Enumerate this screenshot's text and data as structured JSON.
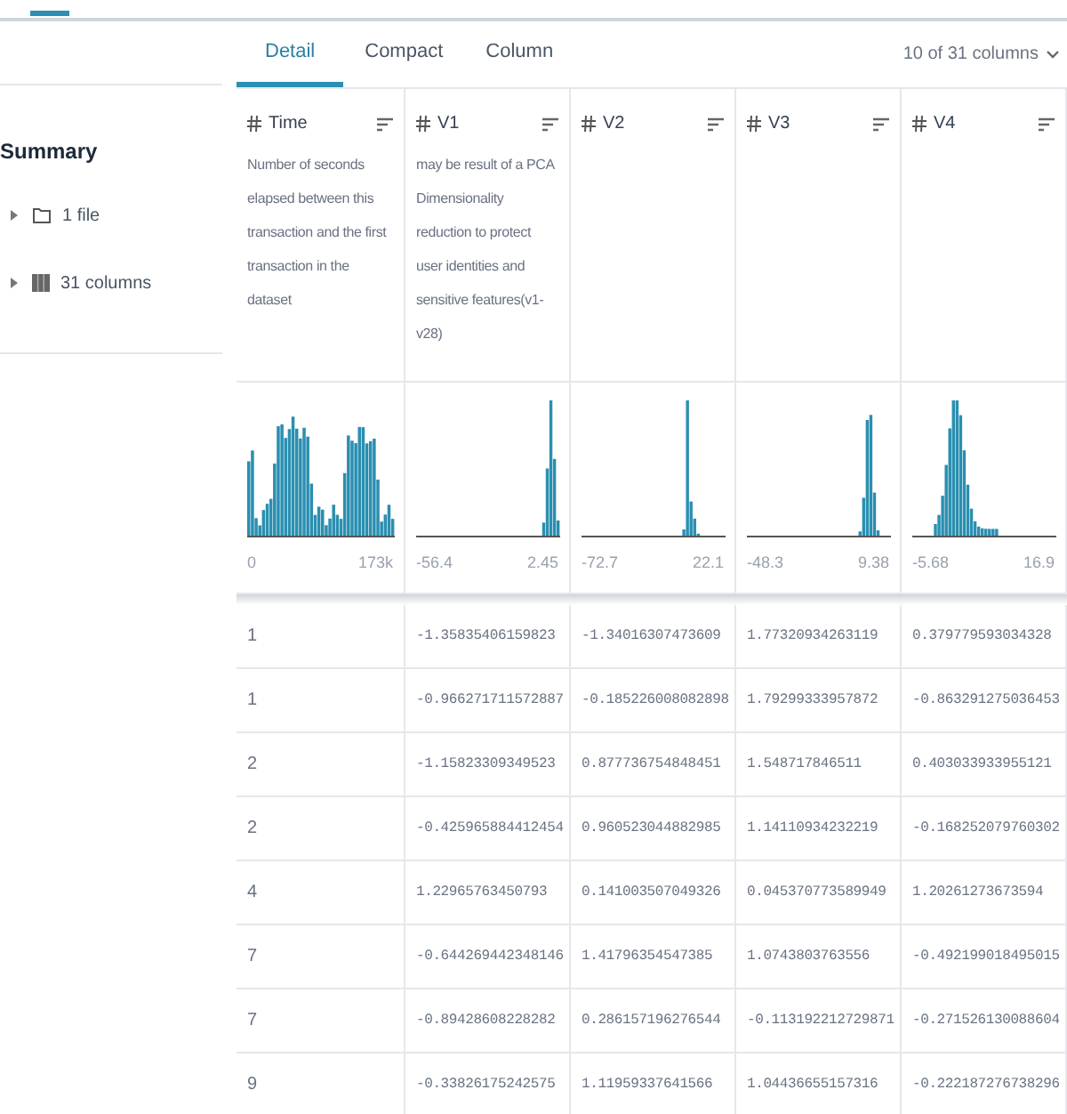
{
  "sidebar": {
    "title": "Summary",
    "items": [
      {
        "kind": "file",
        "label": "1 file",
        "expanded": false
      },
      {
        "kind": "columns",
        "label": "31 columns",
        "expanded": false
      }
    ]
  },
  "tabs": [
    {
      "label": "Detail",
      "selected": true
    },
    {
      "label": "Compact",
      "selected": false
    },
    {
      "label": "Column",
      "selected": false
    }
  ],
  "column_picker": "10 of 31 columns",
  "columns": [
    {
      "name": "Time",
      "description": "Number of seconds elapsed between this transaction and the first transaction in the dataset",
      "kind": "bimodal",
      "min": "0",
      "max": "173k"
    },
    {
      "name": "V1",
      "description": "may be result of a PCA Dimensionality reduction to protect user identities and sensitive features(v1-v28)",
      "kind": "right-skew",
      "min": "-56.4",
      "max": "2.45"
    },
    {
      "name": "V2",
      "kind": "spike",
      "min": "-72.7",
      "max": "22.1"
    },
    {
      "name": "V3",
      "kind": "right-cluster",
      "min": "-48.3",
      "max": "9.38"
    },
    {
      "name": "V4",
      "kind": "left-bell",
      "min": "-5.68",
      "max": "16.9"
    }
  ],
  "rows": [
    [
      "1",
      "-1.35835406159823",
      "-1.34016307473609",
      "1.77320934263119",
      "0.379779593034328"
    ],
    [
      "1",
      "-0.966271711572887",
      "-0.185226008082898",
      "1.79299333957872",
      "-0.863291275036453"
    ],
    [
      "2",
      "-1.15823309349523",
      "0.877736754848451",
      "1.548717846511",
      "0.403033933955121"
    ],
    [
      "2",
      "-0.425965884412454",
      "0.960523044882985",
      "1.14110934232219",
      "-0.168252079760302"
    ],
    [
      "4",
      "1.22965763450793",
      "0.141003507049326",
      "0.045370773589949",
      "1.20261273673594"
    ],
    [
      "7",
      "-0.644269442348146",
      "1.41796354547385",
      "1.0743803763556",
      "-0.492199018495015"
    ],
    [
      "7",
      "-0.89428608228282",
      "0.286157196276544",
      "-0.113192212729871",
      "-0.271526130088604"
    ],
    [
      "9",
      "-0.33826175242575",
      "1.11959337641566",
      "1.04436655157316",
      "-0.222187276738296"
    ]
  ]
}
